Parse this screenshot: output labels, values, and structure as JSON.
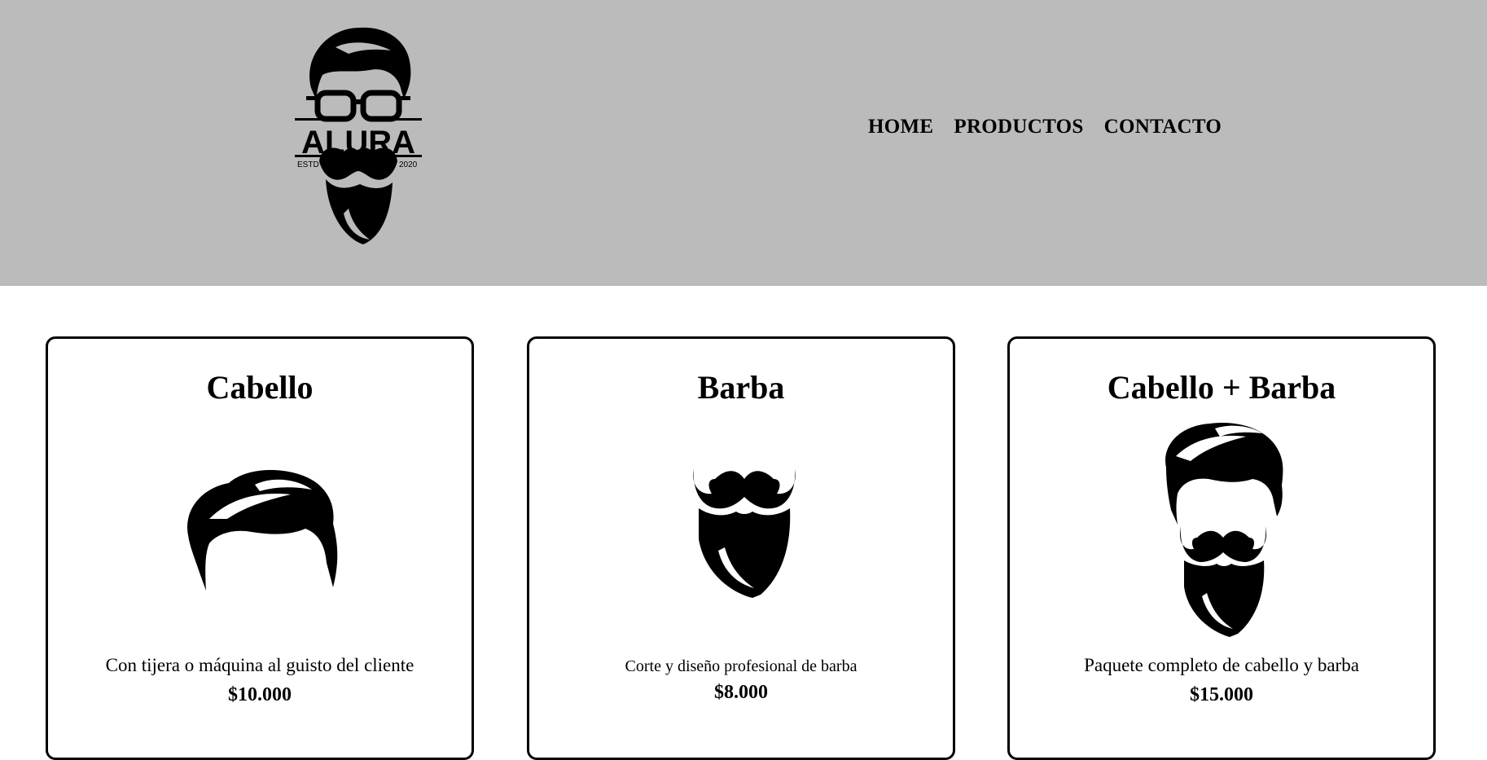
{
  "header": {
    "logo": {
      "name": "ALURA",
      "left_text": "ESTD",
      "right_text": "2020"
    },
    "nav": [
      "HOME",
      "PRODUCTOS",
      "CONTACTO"
    ]
  },
  "cards": [
    {
      "title": "Cabello",
      "icon": "hair-icon",
      "description": "Con tijera o máquina al guisto del cliente",
      "price": "$10.000"
    },
    {
      "title": "Barba",
      "icon": "beard-icon",
      "description": "Corte y diseño profesional de barba",
      "price": "$8.000"
    },
    {
      "title": "Cabello + Barba",
      "icon": "hair-and-beard-icon",
      "description": "Paquete completo de cabello y barba",
      "price": "$15.000"
    }
  ],
  "colors": {
    "header_bg": "#bbbbbb",
    "text": "#000000",
    "card_border": "#000000"
  }
}
